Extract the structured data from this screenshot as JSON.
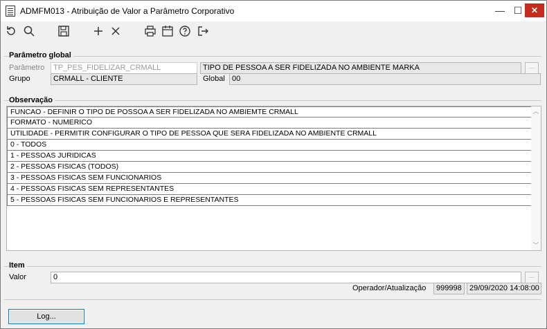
{
  "window": {
    "title": "ADMFM013 - Atribuição de Valor a Parâmetro Corporativo"
  },
  "titlebar_buttons": {
    "minimize": "—",
    "maximize": "☐",
    "close": "✕"
  },
  "toolbar": {
    "icons": [
      "refresh-icon",
      "search-icon",
      "save-icon",
      "add-icon",
      "delete-icon",
      "print-icon",
      "calendar-icon",
      "help-icon",
      "exit-icon"
    ]
  },
  "parametro_global": {
    "legend": "Parâmetro global",
    "parametro_label": "Parâmetro",
    "parametro_value": "TP_PES_FIDELIZAR_CRMALL",
    "parametro_desc": "TIPO DE PESSOA A SER FIDELIZADA NO AMBIENTE MARKA",
    "grupo_label": "Grupo",
    "grupo_value": "CRMALL - CLIENTE",
    "global_label": "Global",
    "global_value": "00"
  },
  "observacao": {
    "legend": "Observação",
    "lines": [
      "FUNCAO - DEFINIR O TIPO DE POSSOA A SER FIDELIZADA NO AMBIEMTE CRMALL",
      "FORMATO - NUMERICO",
      "UTILIDADE - PERMITIR CONFIGURAR O TIPO DE PESSOA QUE SERA FIDELIZADA NO AMBIENTE CRMALL",
      "0 - TODOS",
      "1 - PESSOAS JURIDICAS",
      "2 - PESSOAS FISICAS (TODOS)",
      "3 - PESSOAS FISICAS SEM FUNCIONARIOS",
      "4 - PESSOAS FISICAS SEM REPRESENTANTES",
      "5 - PESSOAS FISICAS SEM FUNCIONARIOS E REPRESENTANTES"
    ]
  },
  "item": {
    "legend": "Item",
    "valor_label": "Valor",
    "valor_value": "0",
    "operador_label": "Operador/Atualização",
    "operador_value": "999998",
    "atualizacao_value": "29/09/2020 14:08:00"
  },
  "log_button": {
    "label": "Log..."
  }
}
